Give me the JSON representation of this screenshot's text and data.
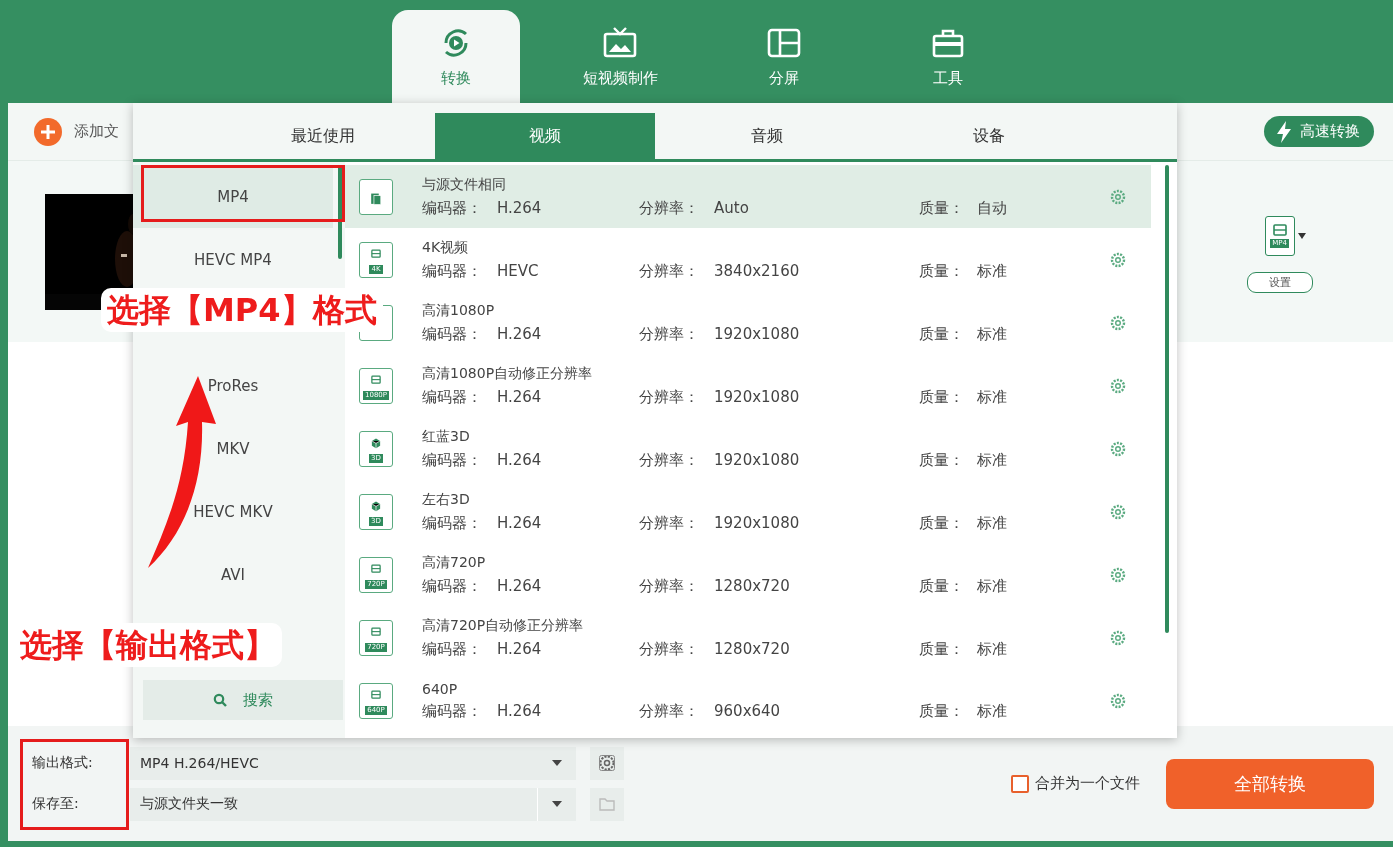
{
  "nav_tabs": [
    {
      "label": "转换",
      "selected": true
    },
    {
      "label": "短视频制作",
      "selected": false
    },
    {
      "label": "分屏",
      "selected": false
    },
    {
      "label": "工具",
      "selected": false
    }
  ],
  "toolbar": {
    "add_file": "添加文",
    "speed_button": "高速转换"
  },
  "file_item": {
    "format_icon_label": "MP4",
    "settings_button": "设置"
  },
  "format_popup": {
    "tabs": [
      {
        "label": "最近使用",
        "selected": false
      },
      {
        "label": "视频",
        "selected": true
      },
      {
        "label": "音频",
        "selected": false
      },
      {
        "label": "设备",
        "selected": false
      }
    ],
    "containers": [
      {
        "label": "MP4",
        "selected": true
      },
      {
        "label": "HEVC MP4",
        "selected": false
      },
      {
        "label": "ProRes",
        "selected": false
      },
      {
        "label": "MKV",
        "selected": false
      },
      {
        "label": "HEVC MKV",
        "selected": false
      },
      {
        "label": "AVI",
        "selected": false
      }
    ],
    "search_button": "搜索",
    "presets": [
      {
        "title": "与源文件相同",
        "kind": "copy",
        "selected": true,
        "fields": [
          {
            "label": "编码器：",
            "value": "H.264"
          },
          {
            "label": "分辨率：",
            "value": "Auto"
          },
          {
            "label": "质量：",
            "value": "自动"
          }
        ]
      },
      {
        "title": "4K视频",
        "kind": "film",
        "badge": "4K",
        "selected": false,
        "fields": [
          {
            "label": "编码器：",
            "value": "HEVC"
          },
          {
            "label": "分辨率：",
            "value": "3840x2160"
          },
          {
            "label": "质量：",
            "value": "标准"
          }
        ]
      },
      {
        "title": "高清1080P",
        "kind": "film",
        "selected": false,
        "fields": [
          {
            "label": "编码器：",
            "value": "H.264"
          },
          {
            "label": "分辨率：",
            "value": "1920x1080"
          },
          {
            "label": "质量：",
            "value": "标准"
          }
        ]
      },
      {
        "title": "高清1080P自动修正分辨率",
        "kind": "film",
        "badge": "1080P",
        "selected": false,
        "fields": [
          {
            "label": "编码器：",
            "value": "H.264"
          },
          {
            "label": "分辨率：",
            "value": "1920x1080"
          },
          {
            "label": "质量：",
            "value": "标准"
          }
        ]
      },
      {
        "title": "红蓝3D",
        "kind": "cube",
        "badge": "3D",
        "selected": false,
        "fields": [
          {
            "label": "编码器：",
            "value": "H.264"
          },
          {
            "label": "分辨率：",
            "value": "1920x1080"
          },
          {
            "label": "质量：",
            "value": "标准"
          }
        ]
      },
      {
        "title": "左右3D",
        "kind": "cube",
        "badge": "3D",
        "selected": false,
        "fields": [
          {
            "label": "编码器：",
            "value": "H.264"
          },
          {
            "label": "分辨率：",
            "value": "1920x1080"
          },
          {
            "label": "质量：",
            "value": "标准"
          }
        ]
      },
      {
        "title": "高清720P",
        "kind": "film",
        "badge": "720P",
        "selected": false,
        "fields": [
          {
            "label": "编码器：",
            "value": "H.264"
          },
          {
            "label": "分辨率：",
            "value": "1280x720"
          },
          {
            "label": "质量：",
            "value": "标准"
          }
        ]
      },
      {
        "title": "高清720P自动修正分辨率",
        "kind": "film",
        "badge": "720P",
        "selected": false,
        "fields": [
          {
            "label": "编码器：",
            "value": "H.264"
          },
          {
            "label": "分辨率：",
            "value": "1280x720"
          },
          {
            "label": "质量：",
            "value": "标准"
          }
        ]
      },
      {
        "title": "640P",
        "kind": "film",
        "badge": "640P",
        "selected": false,
        "fields": [
          {
            "label": "编码器：",
            "value": "H.264"
          },
          {
            "label": "分辨率：",
            "value": "960x640"
          },
          {
            "label": "质量：",
            "value": "标准"
          }
        ]
      }
    ]
  },
  "bottom_bar": {
    "output_format": {
      "label": "输出格式:",
      "value": "MP4 H.264/HEVC"
    },
    "save_to": {
      "label": "保存至:",
      "value": "与源文件夹一致"
    },
    "merge": {
      "label": "合并为一个文件",
      "checked": false
    },
    "convert_all_button": "全部转换"
  },
  "annotations": [
    {
      "text": "选择【MP4】格式",
      "kind": "callout-upper"
    },
    {
      "text": "选择【输出格式】",
      "kind": "callout-lower"
    }
  ]
}
